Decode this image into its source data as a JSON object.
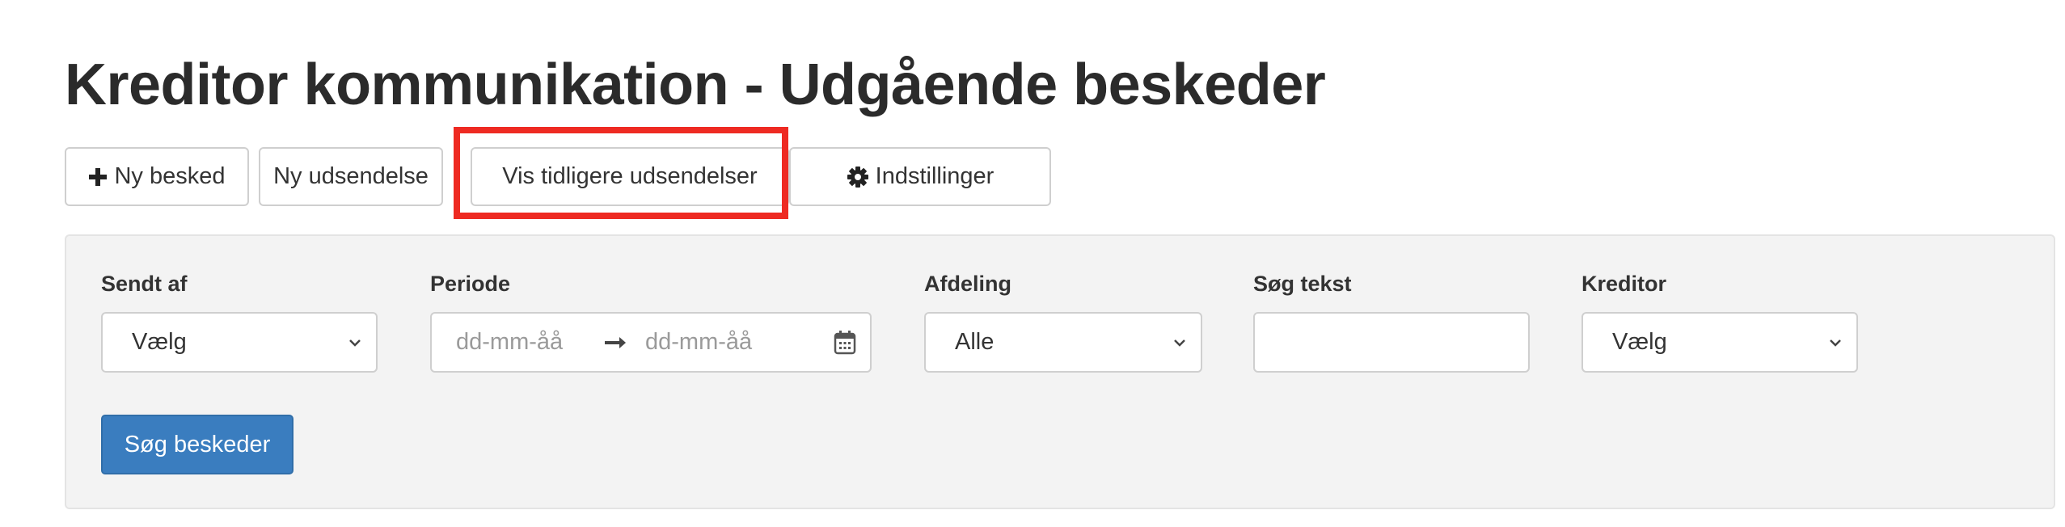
{
  "page": {
    "title": "Kreditor kommunikation - Udgående beskeder"
  },
  "toolbar": {
    "new_message_label": "Ny besked",
    "new_broadcast_label": "Ny udsendelse",
    "previous_broadcasts_label": "Vis tidligere udsendelser",
    "settings_label": "Indstillinger"
  },
  "filters": {
    "sent_by": {
      "label": "Sendt af",
      "value": "Vælg"
    },
    "period": {
      "label": "Periode",
      "from_placeholder": "dd-mm-åå",
      "to_placeholder": "dd-mm-åå"
    },
    "department": {
      "label": "Afdeling",
      "value": "Alle"
    },
    "search_text": {
      "label": "Søg tekst",
      "value": ""
    },
    "creditor": {
      "label": "Kreditor",
      "value": "Vælg"
    },
    "search_button_label": "Søg beskeder"
  },
  "colors": {
    "primary_button": "#3a7dbf",
    "highlight": "#ee2a22",
    "panel_background": "#f3f3f3"
  },
  "icons": {
    "new_message": "plus-icon",
    "settings": "gear-icon",
    "dropdown": "chevron-down-icon",
    "range_arrow": "arrow-right-icon",
    "calendar": "calendar-icon"
  }
}
